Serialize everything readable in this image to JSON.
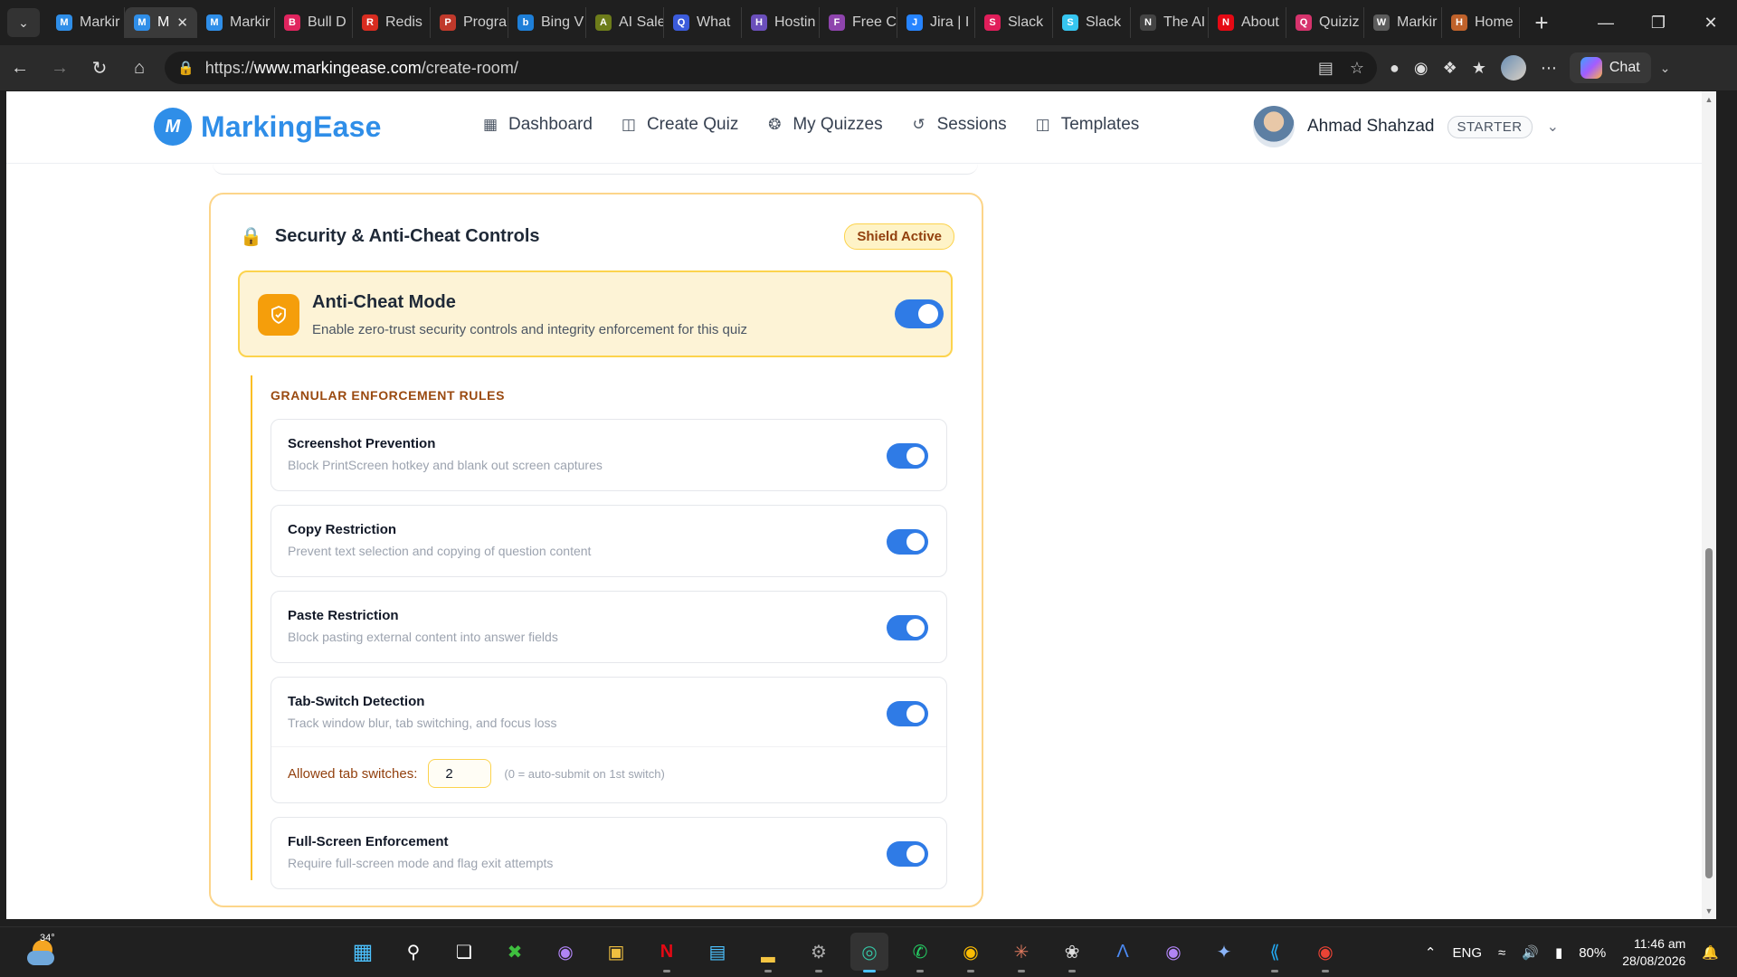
{
  "browser": {
    "tabs": [
      {
        "label": "Markir",
        "color": "#2f8ee8",
        "glyph": "M"
      },
      {
        "label": "M",
        "color": "#2f8ee8",
        "glyph": "M",
        "active": true
      },
      {
        "label": "Markir",
        "color": "#2f8ee8",
        "glyph": "M"
      },
      {
        "label": "Bull D",
        "color": "#e0245e",
        "glyph": "B"
      },
      {
        "label": "Redis",
        "color": "#d82c20",
        "glyph": "R"
      },
      {
        "label": "Progra",
        "color": "#c0392b",
        "glyph": "P"
      },
      {
        "label": "Bing V",
        "color": "#1e7fd8",
        "glyph": "b"
      },
      {
        "label": "AI Sale",
        "color": "#6d7c1a",
        "glyph": "A"
      },
      {
        "label": "What",
        "color": "#3b5bdb",
        "glyph": "Q"
      },
      {
        "label": "Hostin",
        "color": "#6b4fbb",
        "glyph": "H"
      },
      {
        "label": "Free C",
        "color": "#8e44ad",
        "glyph": "F"
      },
      {
        "label": "Jira | I",
        "color": "#2684ff",
        "glyph": "J"
      },
      {
        "label": "Slack",
        "color": "#e01e5a",
        "glyph": "S"
      },
      {
        "label": "Slack",
        "color": "#36c5f0",
        "glyph": "S"
      },
      {
        "label": "The AI",
        "color": "#444444",
        "glyph": "N"
      },
      {
        "label": "About",
        "color": "#e50914",
        "glyph": "N"
      },
      {
        "label": "Quiziz",
        "color": "#d6336c",
        "glyph": "Q"
      },
      {
        "label": "Markir",
        "color": "#5c5c5c",
        "glyph": "W"
      },
      {
        "label": "Home",
        "color": "#c0622b",
        "glyph": "H"
      }
    ],
    "url_prefix": "https://",
    "url_host": "www.markingease.com",
    "url_path": "/create-room/",
    "chat_label": "Chat"
  },
  "app": {
    "brand": "MarkingEase",
    "brand_color": "#2f8ee8",
    "nav": [
      {
        "label": "Dashboard",
        "icon": "dashboard-icon"
      },
      {
        "label": "Create Quiz",
        "icon": "book-icon"
      },
      {
        "label": "My Quizzes",
        "icon": "brain-icon"
      },
      {
        "label": "Sessions",
        "icon": "history-icon"
      },
      {
        "label": "Templates",
        "icon": "book-icon"
      }
    ],
    "user": {
      "name": "Ahmad Shahzad",
      "plan": "STARTER"
    }
  },
  "security": {
    "title": "Security & Anti-Cheat Controls",
    "badge": "Shield Active",
    "anticheat": {
      "title": "Anti-Cheat Mode",
      "description": "Enable zero-trust security controls and integrity enforcement for this quiz",
      "enabled": true
    },
    "rules_heading": "GRANULAR ENFORCEMENT RULES",
    "rules": [
      {
        "name": "Screenshot Prevention",
        "description": "Block PrintScreen hotkey and blank out screen captures",
        "enabled": true
      },
      {
        "name": "Copy Restriction",
        "description": "Prevent text selection and copying of question content",
        "enabled": true
      },
      {
        "name": "Paste Restriction",
        "description": "Block pasting external content into answer fields",
        "enabled": true
      },
      {
        "name": "Tab-Switch Detection",
        "description": "Track window blur, tab switching, and focus loss",
        "enabled": true
      },
      {
        "name": "Full-Screen Enforcement",
        "description": "Require full-screen mode and flag exit attempts",
        "enabled": true
      }
    ],
    "tab_switch": {
      "label": "Allowed tab switches:",
      "value": "2",
      "hint": "(0 = auto-submit on 1st switch)"
    }
  },
  "taskbar": {
    "weather_temp": "34°",
    "language": "ENG",
    "battery": "80%",
    "time": "11:46 am",
    "date": "28/08/2026"
  }
}
